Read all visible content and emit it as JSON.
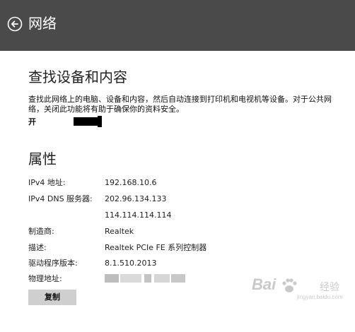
{
  "header": {
    "title": "网络",
    "back_icon": "back-arrow-circle-icon",
    "background": "#4a4a4a"
  },
  "discovery": {
    "title": "查找设备和内容",
    "description": "查找此网络上的电脑、设备和内容，然后自动连接到打印机和电视机等设备。对于公共网络，关闭此功能将有助于确保你的资料安全。",
    "toggle_label": "开",
    "toggle_state": "on"
  },
  "properties": {
    "title": "属性",
    "items": [
      {
        "label": "IPv4 地址:",
        "value": "192.168.10.6"
      },
      {
        "label": "IPv4 DNS 服务器:",
        "value": "202.96.134.133"
      },
      {
        "label": "",
        "value": "114.114.114.114"
      },
      {
        "label": "制造商:",
        "value": "Realtek"
      },
      {
        "label": "描述:",
        "value": "Realtek PCIe FE 系列控制器"
      },
      {
        "label": "驱动程序版本:",
        "value": "8.1.510.2013"
      },
      {
        "label": "物理地址:",
        "value": ""
      }
    ],
    "copy_label": "复制"
  },
  "watermark": {
    "brand": "Bai",
    "suffix": "经验",
    "url": "jingyan.baidu.com"
  }
}
